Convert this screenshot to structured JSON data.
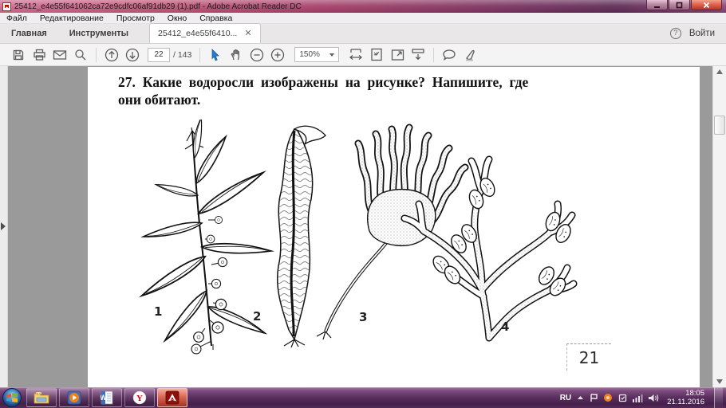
{
  "window": {
    "title": "25412_e4e55f641062ca72e9cdfc06af91db29 (1).pdf - Adobe Acrobat Reader DC"
  },
  "menu_bar": {
    "items": [
      "Файл",
      "Редактирование",
      "Просмотр",
      "Окно",
      "Справка"
    ]
  },
  "tab_bar": {
    "home": "Главная",
    "tools": "Инструменты",
    "document_tab": "25412_e4e55f6410...",
    "sign_in": "Войти"
  },
  "toolbar": {
    "current_page": "22",
    "total_pages": "/ 143",
    "zoom_level": "150%"
  },
  "content": {
    "question_line1": "27. Какие водоросли изображены на рисунке? Напишите, где",
    "question_line2": "они обитают.",
    "figure_labels": [
      "1",
      "2",
      "3",
      "4"
    ],
    "page_number": "21"
  },
  "taskbar": {
    "language": "RU",
    "time": "18:05",
    "date": "21.11.2016"
  },
  "colors": {
    "titlebar_magenta": "#a43e68",
    "taskbar_purple": "#5d3261",
    "selection_blue": "#2a7cc7",
    "adobe_red": "#c00c00",
    "doc_background_gray": "#9a9a9a"
  }
}
